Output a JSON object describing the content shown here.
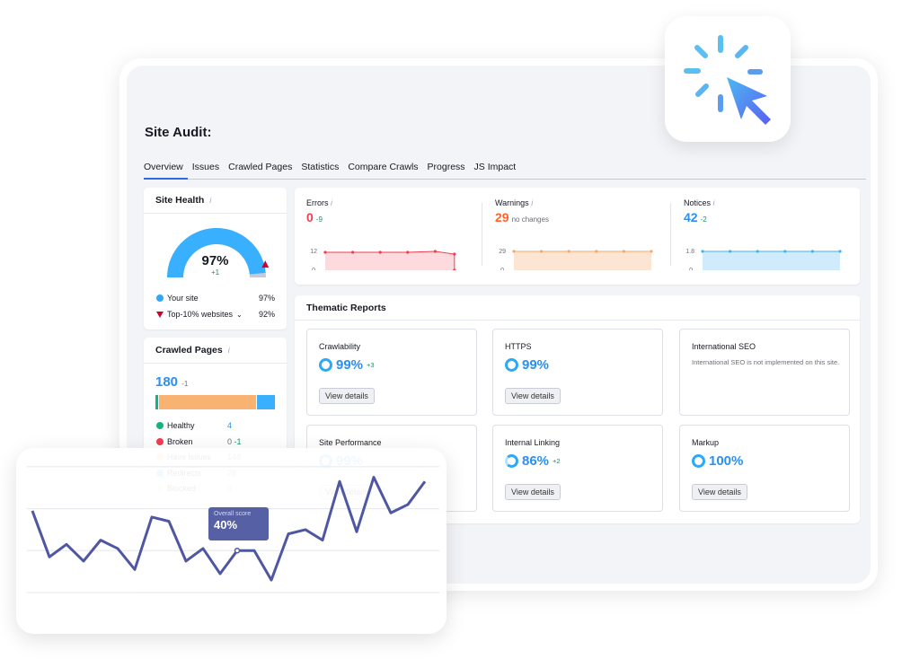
{
  "page": {
    "title": "Site Audit:"
  },
  "tabs": [
    {
      "label": "Overview",
      "active": true
    },
    {
      "label": "Issues"
    },
    {
      "label": "Crawled Pages"
    },
    {
      "label": "Statistics"
    },
    {
      "label": "Compare Crawls"
    },
    {
      "label": "Progress"
    },
    {
      "label": "JS Impact"
    }
  ],
  "site_health": {
    "title": "Site Health",
    "info_icon": "info-icon",
    "value": "97%",
    "value_fraction": 0.97,
    "delta": "+1",
    "legend": [
      {
        "label": "Your site",
        "value": "97%",
        "color": "#2ea9f5"
      },
      {
        "label": "Top-10% websites",
        "value": "92%",
        "color": "#d1002f",
        "dropdown": true
      }
    ]
  },
  "crawled_pages": {
    "title": "Crawled Pages",
    "total": "180",
    "delta": "-1",
    "rows": [
      {
        "label": "Healthy",
        "value": "4",
        "delta": "",
        "color": "#15b37d",
        "count": 4
      },
      {
        "label": "Broken",
        "value": "0",
        "delta": "-1",
        "color": "#f23d4f",
        "count": 0
      },
      {
        "label": "Have issues",
        "value": "148",
        "delta": "",
        "color": "#f8b272",
        "count": 148
      },
      {
        "label": "Redirects",
        "value": "28",
        "delta": "",
        "color": "#38b0ff",
        "count": 28
      },
      {
        "label": "Blocked",
        "value": "0",
        "delta": "",
        "color": "#d6d9e0",
        "count": 0
      }
    ]
  },
  "issues": [
    {
      "label": "Errors",
      "value": "0",
      "delta": "-9",
      "color": "#f23d4f",
      "fill": "#fcdadd",
      "ymax_label": "12",
      "ymin_label": "0",
      "points": [
        10,
        10,
        10,
        10,
        10.5,
        9,
        0
      ],
      "delta_color": "#15955f"
    },
    {
      "label": "Warnings",
      "value": "29",
      "delta": "no changes",
      "color": "#ff642d",
      "line": "#f8a76c",
      "fill": "#fde5d4",
      "ymax_label": "29",
      "ymin_label": "0",
      "points": [
        29,
        29,
        29,
        29,
        29,
        29
      ],
      "delta_color": "#6c6e79"
    },
    {
      "label": "Notices",
      "value": "42",
      "delta": "-2",
      "color": "#2b8ff0",
      "line": "#40b4f5",
      "fill": "#d0ecfc",
      "ymax_label": "1.8",
      "ymin_label": "0",
      "points": [
        1.8,
        1.8,
        1.8,
        1.8,
        1.8,
        1.8
      ],
      "delta_color": "#15955f"
    }
  ],
  "thematic": {
    "title": "Thematic Reports",
    "reports": [
      {
        "name": "Crawlability",
        "value": "99%",
        "delta": "+3",
        "button": "View details"
      },
      {
        "name": "HTTPS",
        "value": "99%",
        "delta": "",
        "button": "View details"
      },
      {
        "name": "International SEO",
        "description": "International SEO is not implemented on this site."
      },
      {
        "name": "Site Performance",
        "value": "99%",
        "delta": "",
        "button": "View details"
      },
      {
        "name": "Internal Linking",
        "value": "86%",
        "delta": "+2",
        "button": "View details"
      },
      {
        "name": "Markup",
        "value": "100%",
        "delta": "",
        "button": "View details"
      }
    ]
  },
  "cursor_icon": "click-cursor-icon",
  "chart_data": {
    "type": "line",
    "title": "",
    "xlabel": "",
    "ylabel": "",
    "ylim": [
      0,
      100
    ],
    "grid": true,
    "series": [
      {
        "name": "Overall score",
        "color": "#4f57a3",
        "values": [
          59,
          37,
          43,
          35,
          45,
          41,
          31,
          56,
          54,
          35,
          41,
          29,
          40,
          40,
          26,
          48,
          50,
          45,
          73,
          49,
          75,
          58,
          62,
          73
        ]
      }
    ],
    "tooltip": {
      "label": "Overall score",
      "value": "40%",
      "index": 12
    }
  }
}
